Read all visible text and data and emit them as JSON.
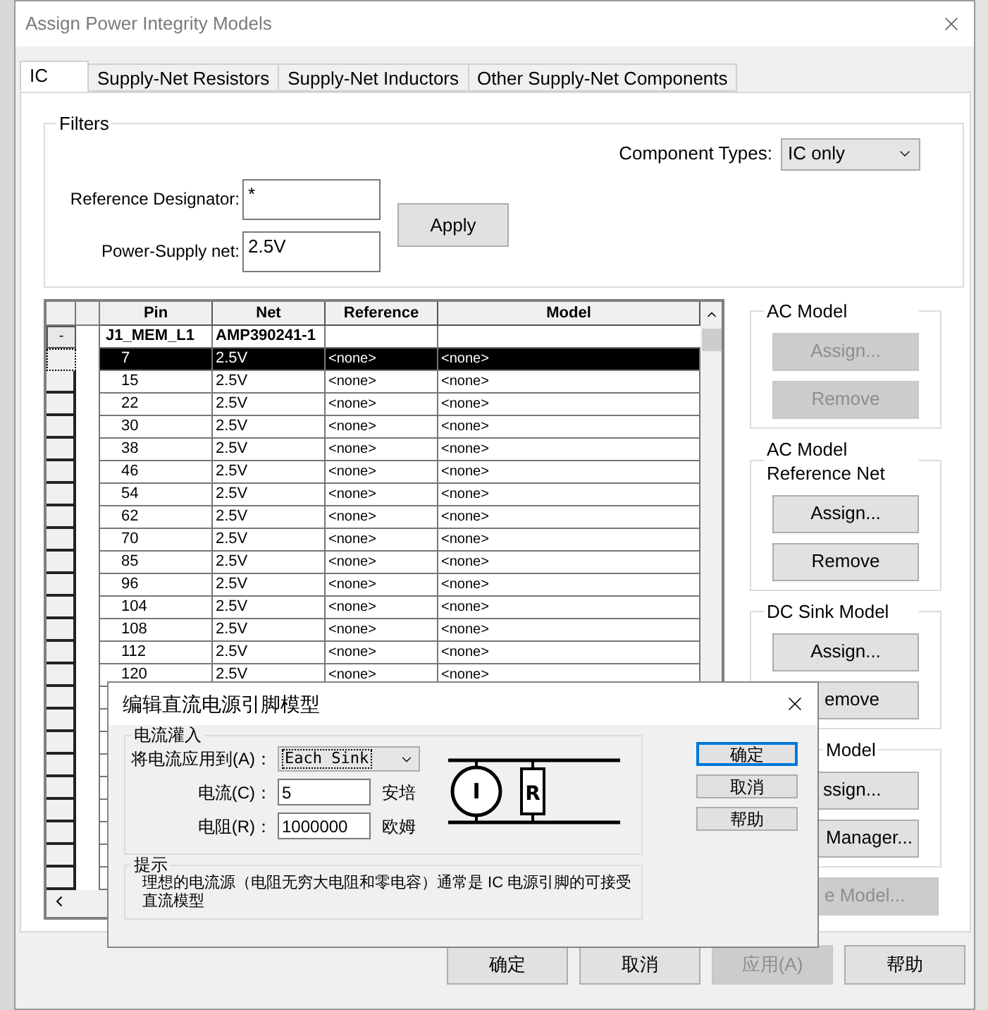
{
  "window": {
    "title": "Assign Power Integrity Models"
  },
  "tabs": [
    {
      "label": "IC",
      "selected": true
    },
    {
      "label": "Supply-Net Resistors",
      "selected": false
    },
    {
      "label": "Supply-Net Inductors",
      "selected": false
    },
    {
      "label": "Other Supply-Net Components",
      "selected": false
    }
  ],
  "filters": {
    "title": "Filters",
    "component_types": {
      "label": "Component Types:",
      "value": "IC only"
    },
    "reference_designator": {
      "label": "Reference Designator:",
      "value": "*"
    },
    "power_supply_net": {
      "label": "Power-Supply net:",
      "value": "2.5V"
    },
    "apply_button": "Apply"
  },
  "grid": {
    "columns": [
      "Pin",
      "Net",
      "Reference",
      "Model"
    ],
    "group": {
      "collapse_glyph": "-",
      "name": "J1_MEM_L1",
      "net": "AMP390241-1"
    },
    "rows": [
      {
        "pin": "7",
        "net": "2.5V",
        "reference": "<none>",
        "model": "<none>",
        "selected": true
      },
      {
        "pin": "15",
        "net": "2.5V",
        "reference": "<none>",
        "model": "<none>",
        "selected": false
      },
      {
        "pin": "22",
        "net": "2.5V",
        "reference": "<none>",
        "model": "<none>",
        "selected": false
      },
      {
        "pin": "30",
        "net": "2.5V",
        "reference": "<none>",
        "model": "<none>",
        "selected": false
      },
      {
        "pin": "38",
        "net": "2.5V",
        "reference": "<none>",
        "model": "<none>",
        "selected": false
      },
      {
        "pin": "46",
        "net": "2.5V",
        "reference": "<none>",
        "model": "<none>",
        "selected": false
      },
      {
        "pin": "54",
        "net": "2.5V",
        "reference": "<none>",
        "model": "<none>",
        "selected": false
      },
      {
        "pin": "62",
        "net": "2.5V",
        "reference": "<none>",
        "model": "<none>",
        "selected": false
      },
      {
        "pin": "70",
        "net": "2.5V",
        "reference": "<none>",
        "model": "<none>",
        "selected": false
      },
      {
        "pin": "85",
        "net": "2.5V",
        "reference": "<none>",
        "model": "<none>",
        "selected": false
      },
      {
        "pin": "96",
        "net": "2.5V",
        "reference": "<none>",
        "model": "<none>",
        "selected": false
      },
      {
        "pin": "104",
        "net": "2.5V",
        "reference": "<none>",
        "model": "<none>",
        "selected": false
      },
      {
        "pin": "108",
        "net": "2.5V",
        "reference": "<none>",
        "model": "<none>",
        "selected": false
      },
      {
        "pin": "112",
        "net": "2.5V",
        "reference": "<none>",
        "model": "<none>",
        "selected": false
      },
      {
        "pin": "120",
        "net": "2.5V",
        "reference": "<none>",
        "model": "<none>",
        "selected": false
      }
    ]
  },
  "right_groups": [
    {
      "title": "AC Model",
      "buttons": [
        {
          "label": "Assign...",
          "disabled": true
        },
        {
          "label": "Remove",
          "disabled": true
        }
      ]
    },
    {
      "title": "AC Model Reference Net",
      "buttons": [
        {
          "label": "Assign...",
          "disabled": false
        },
        {
          "label": "Remove",
          "disabled": false
        }
      ]
    },
    {
      "title": "DC Sink Model",
      "buttons": [
        {
          "label": "Assign...",
          "disabled": false
        },
        {
          "label": "emove",
          "disabled": false
        }
      ]
    },
    {
      "title": "Model",
      "buttons": [
        {
          "label": "ssign...",
          "disabled": false
        },
        {
          "label": "Manager...",
          "disabled": false
        }
      ]
    }
  ],
  "extra_button": {
    "label": "e Model...",
    "disabled": true
  },
  "bottom_buttons": [
    {
      "label": "确定",
      "disabled": false
    },
    {
      "label": "取消",
      "disabled": false
    },
    {
      "label": "应用(A)",
      "disabled": true
    },
    {
      "label": "帮助",
      "disabled": false
    }
  ],
  "dialog": {
    "title": "编辑直流电源引脚模型",
    "group_title": "电流灌入",
    "fields": [
      {
        "kind": "combo",
        "label": "将电流应用到(A)：",
        "value": "Each Sink"
      },
      {
        "kind": "text",
        "label": "电流(C)：",
        "value": "5",
        "unit": "安培"
      },
      {
        "kind": "text",
        "label": "电阻(R)：",
        "value": "1000000",
        "unit": "欧姆"
      }
    ],
    "circuit": {
      "source_label": "I",
      "resistor_label": "R"
    },
    "buttons": [
      {
        "label": "确定",
        "focused": true
      },
      {
        "label": "取消",
        "focused": false
      },
      {
        "label": "帮助",
        "focused": false
      }
    ],
    "hint": {
      "title": "提示",
      "text": "理想的电流源（电阻无穷大电阻和零电容）通常是 IC 电源引脚的可接受直流模型"
    }
  }
}
